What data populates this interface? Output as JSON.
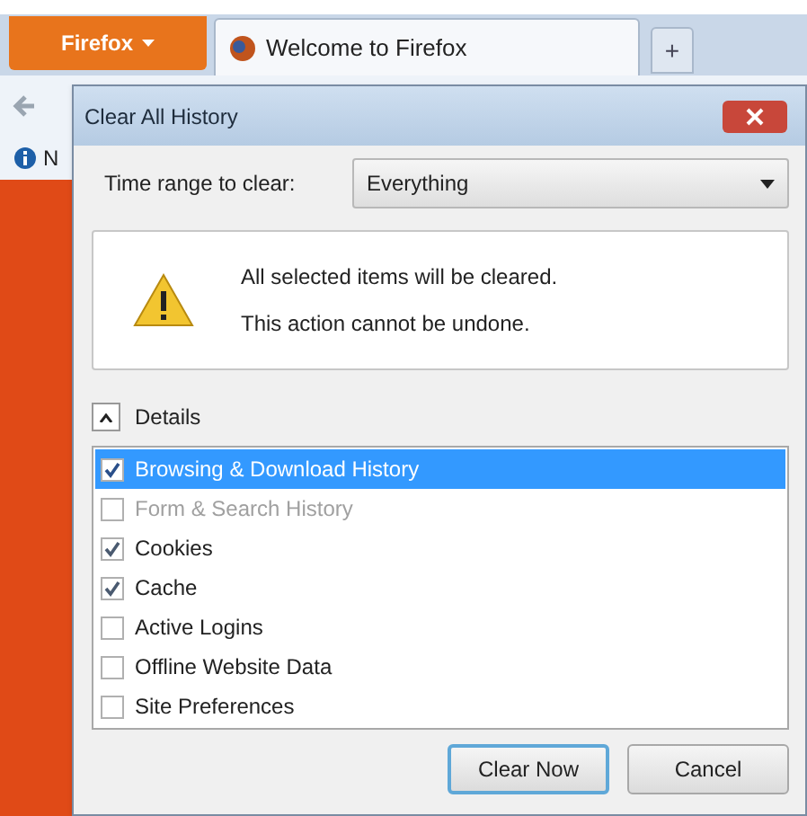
{
  "browser": {
    "menu_button": "Firefox",
    "tabs": [
      {
        "label": "Welcome to Firefox",
        "selected": true
      }
    ],
    "new_tab": "+",
    "info_text": "N"
  },
  "dialog": {
    "title": "Clear All History",
    "time_range": {
      "label": "Time range to clear:",
      "value": "Everything"
    },
    "warning": [
      "All selected items will be cleared.",
      "This action cannot be undone."
    ],
    "details": {
      "label": "Details",
      "expanded": true
    },
    "items": [
      {
        "label": "Browsing & Download History",
        "checked": true,
        "selected": true,
        "disabled": false
      },
      {
        "label": "Form & Search History",
        "checked": false,
        "selected": false,
        "disabled": true
      },
      {
        "label": "Cookies",
        "checked": true,
        "selected": false,
        "disabled": false
      },
      {
        "label": "Cache",
        "checked": true,
        "selected": false,
        "disabled": false
      },
      {
        "label": "Active Logins",
        "checked": false,
        "selected": false,
        "disabled": false
      },
      {
        "label": "Offline Website Data",
        "checked": false,
        "selected": false,
        "disabled": false
      },
      {
        "label": "Site Preferences",
        "checked": false,
        "selected": false,
        "disabled": false
      }
    ],
    "buttons": [
      {
        "label": "Clear Now",
        "default": true
      },
      {
        "label": "Cancel",
        "default": false
      }
    ]
  }
}
